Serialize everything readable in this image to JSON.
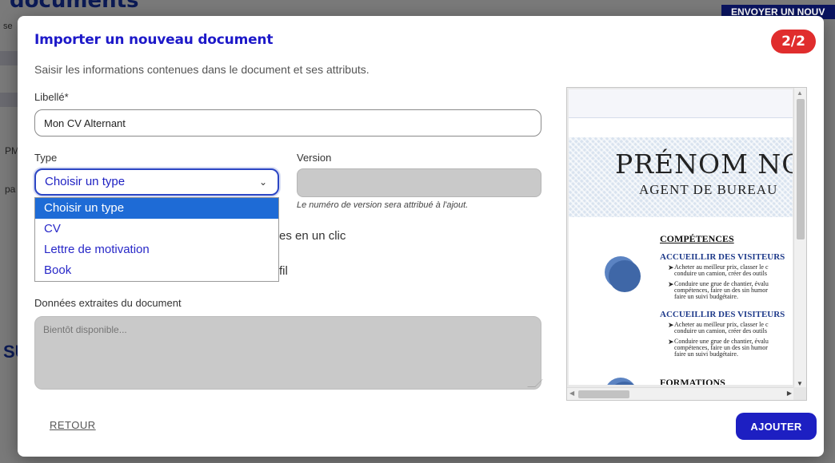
{
  "background": {
    "page_title": "documents",
    "send_button": "ENVOYER UN NOUV",
    "fragments": [
      "se",
      "PM",
      "pa",
      "SU"
    ]
  },
  "modal": {
    "title": "Importer un nouveau document",
    "step": "2/2",
    "subtitle": "Saisir les informations contenues dans le document et ses attributs.",
    "libelle": {
      "label": "Libellé*",
      "value": "Mon CV Alternant"
    },
    "type": {
      "label": "Type",
      "selected": "Choisir un type",
      "options": [
        "Choisir un type",
        "CV",
        "Lettre de motivation",
        "Book"
      ]
    },
    "version": {
      "label": "Version",
      "hint": "Le numéro de version sera attribué à l'ajout."
    },
    "hidden_fragments": [
      "es en un clic",
      "fil"
    ],
    "extracted": {
      "label": "Données extraites du document",
      "placeholder": "Bientôt disponible..."
    },
    "back_label": "RETOUR",
    "add_label": "AJOUTER"
  },
  "preview": {
    "name": "PRÉNOM NOM",
    "role": "AGENT DE BUREAU",
    "section_skills": "COMPÉTENCES",
    "sub_1": "ACCUEILLIR DES VISITEURS",
    "sub_2": "ACCUEILLIR DES VISITEURS",
    "bullet_a1": "Acheter au meilleur prix, classer le c",
    "bullet_a2": "conduire un camion, créer des outils",
    "bullet_b1": "Conduire une grue de chantier, évalu",
    "bullet_b2": "compétences, faire un des sin humor",
    "bullet_b3": "faire un suivi budgétaire.",
    "section_training": "FORMATIONS"
  },
  "colors": {
    "accent": "#1d1fc2",
    "badge": "#e02d2d",
    "dropdown_selected": "#1e6bd6",
    "disabled_field": "#c9c9c9"
  }
}
